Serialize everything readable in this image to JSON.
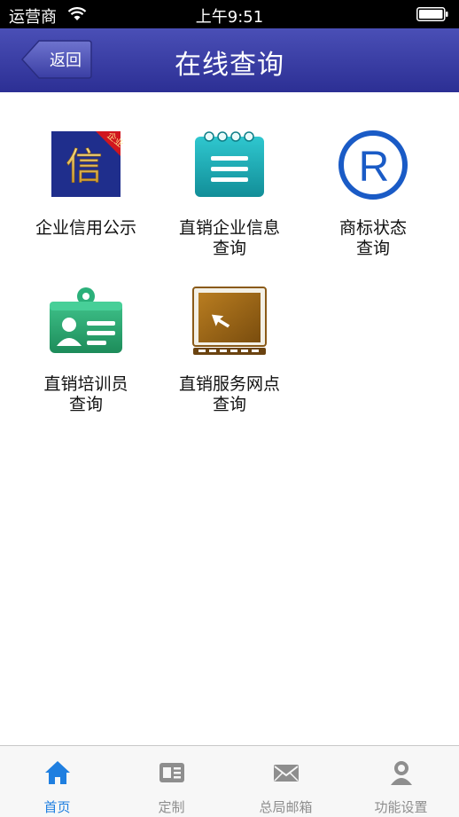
{
  "status_bar": {
    "carrier": "运营商",
    "time": "上午9:51"
  },
  "nav": {
    "back_label": "返回",
    "title": "在线查询"
  },
  "grid": [
    {
      "label": "企业信用公示",
      "icon": "credit-badge-icon",
      "badge_text": "企业",
      "glyph": "信"
    },
    {
      "label": "直销企业信息\n查询",
      "icon": "notepad-icon"
    },
    {
      "label": "商标状态\n查询",
      "icon": "registered-mark-icon",
      "glyph": "R"
    },
    {
      "label": "直销培训员\n查询",
      "icon": "id-badge-icon"
    },
    {
      "label": "直销服务网点\n查询",
      "icon": "monitor-cursor-icon"
    }
  ],
  "tabs": [
    {
      "label": "首页",
      "icon": "home-icon",
      "active": true
    },
    {
      "label": "定制",
      "icon": "news-icon",
      "active": false
    },
    {
      "label": "总局邮箱",
      "icon": "mail-icon",
      "active": false
    },
    {
      "label": "功能设置",
      "icon": "user-settings-icon",
      "active": false
    }
  ],
  "colors": {
    "nav_top": "#4a4fb6",
    "nav_bottom": "#2c2f94",
    "tab_active": "#1f7fe0",
    "tab_inactive": "#8e8e8e"
  }
}
